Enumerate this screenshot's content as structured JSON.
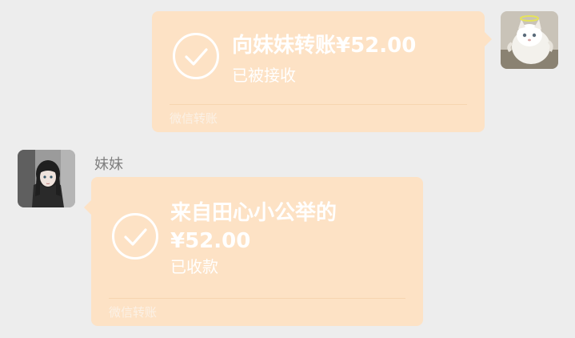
{
  "colors": {
    "background": "#ededed",
    "bubble": "#fde2c5",
    "bubble_text": "#ffffff"
  },
  "messages": [
    {
      "direction": "outgoing",
      "avatar_icon": "cat-avatar-icon",
      "title": "向妹妹转账¥52.00",
      "status": "已被接收",
      "footer": "微信转账",
      "icon": "checkmark-circle-icon"
    },
    {
      "direction": "incoming",
      "sender_name": "妹妹",
      "avatar_icon": "girl-avatar-icon",
      "title_line1": "来自田心小公举的",
      "title_line2": "¥52.00",
      "status": "已收款",
      "footer": "微信转账",
      "icon": "checkmark-circle-icon"
    }
  ]
}
